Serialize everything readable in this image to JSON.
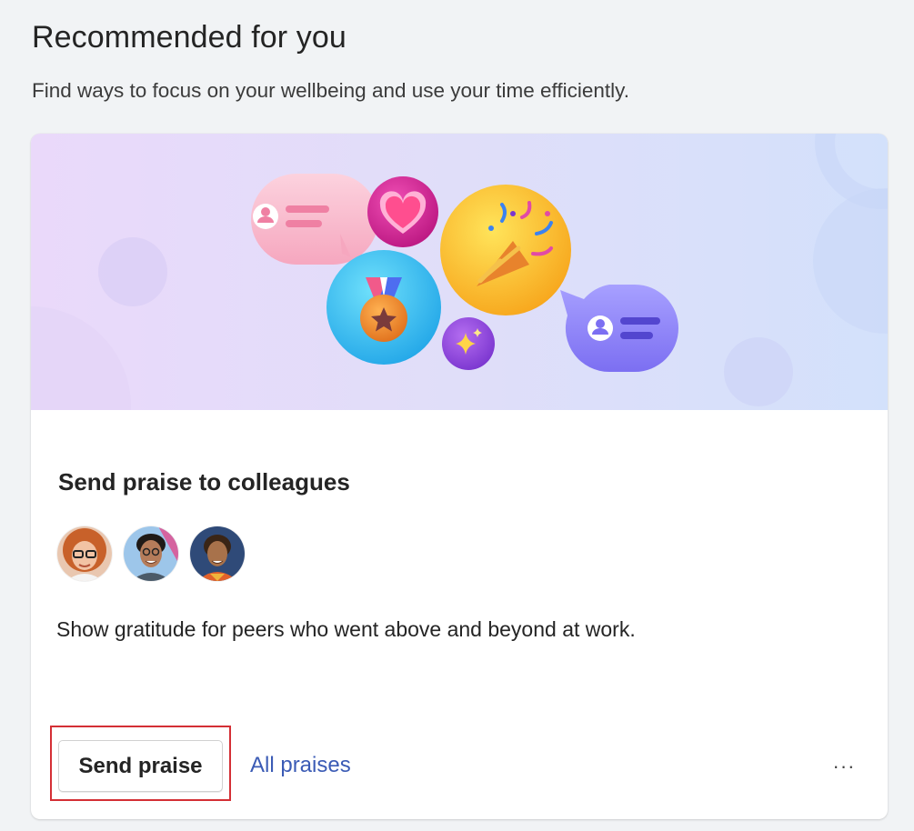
{
  "header": {
    "title": "Recommended for you",
    "subtitle": "Find ways to focus on your wellbeing and use your time efficiently."
  },
  "card": {
    "title": "Send praise to colleagues",
    "description": "Show gratitude for peers who went above and beyond at work.",
    "avatars": [
      "avatar-person-1",
      "avatar-person-2",
      "avatar-person-3"
    ],
    "primary_button": "Send praise",
    "secondary_link": "All praises",
    "more_label": "···"
  },
  "colors": {
    "link": "#3b5bb5",
    "highlight": "#d42f35",
    "background": "#f1f3f5"
  },
  "icons": [
    "chat-bubble-pink-icon",
    "heart-icon",
    "party-popper-icon",
    "medal-icon",
    "sparkles-icon",
    "chat-bubble-purple-icon",
    "more-icon"
  ]
}
